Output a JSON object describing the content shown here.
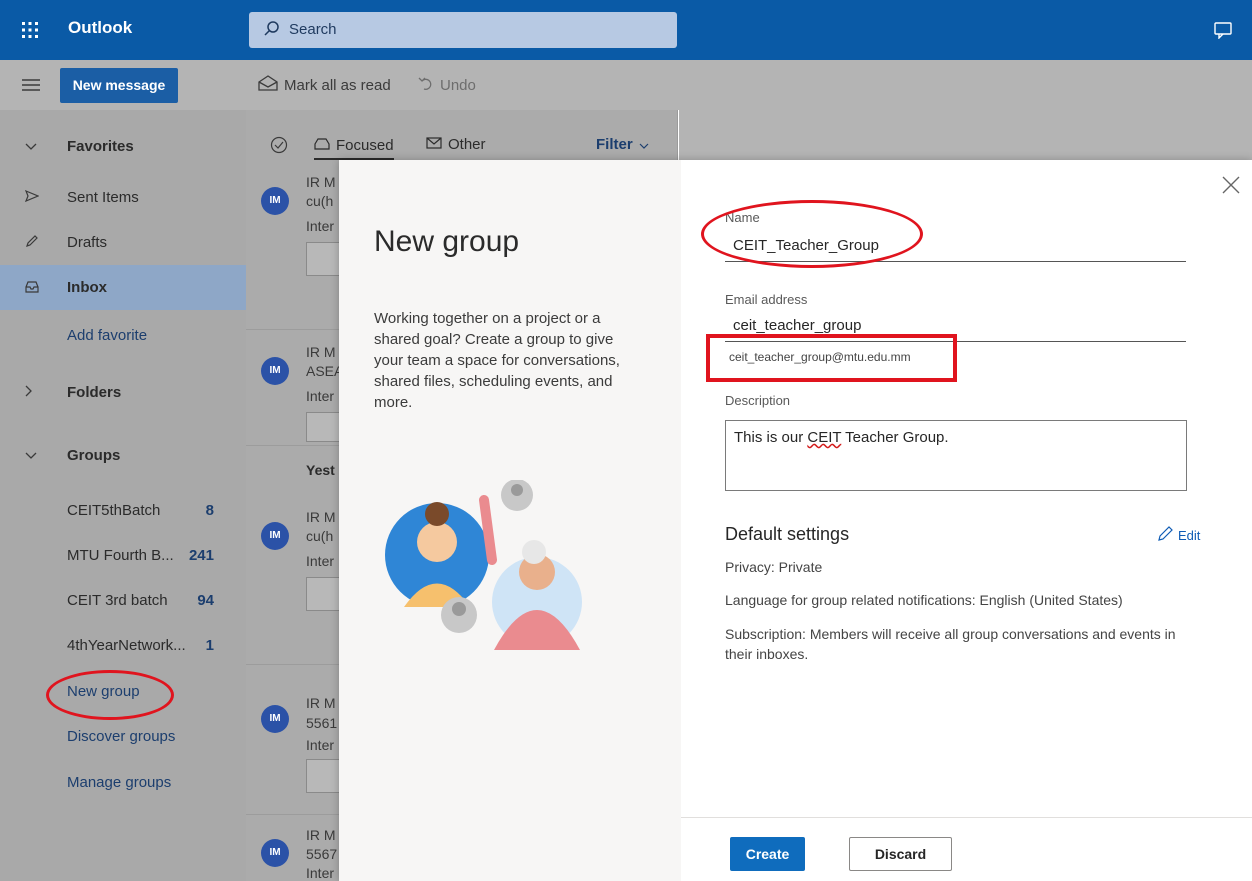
{
  "app": {
    "title": "Outlook"
  },
  "search": {
    "placeholder": "Search"
  },
  "toolbar": {
    "new_message": "New message",
    "mark_all_read": "Mark all as read",
    "undo": "Undo"
  },
  "sidebar": {
    "favorites": "Favorites",
    "sent_items": "Sent Items",
    "drafts": "Drafts",
    "inbox": "Inbox",
    "add_favorite": "Add favorite",
    "folders": "Folders",
    "groups": "Groups",
    "group_items": [
      {
        "label": "CEIT5thBatch",
        "count": "8"
      },
      {
        "label": "MTU Fourth B...",
        "count": "241"
      },
      {
        "label": "CEIT 3rd batch",
        "count": "94"
      },
      {
        "label": "4thYearNetwork...",
        "count": "1"
      }
    ],
    "new_group": "New group",
    "discover_groups": "Discover groups",
    "manage_groups": "Manage groups"
  },
  "list": {
    "tab_focused": "Focused",
    "tab_other": "Other",
    "filter": "Filter",
    "yesterday": "Yest",
    "items": [
      {
        "avatar": "IM",
        "line1": "IR M",
        "line2": "cu(h",
        "line3": "Inter"
      },
      {
        "avatar": "IM",
        "line1": "IR M",
        "line2": "ASEA",
        "line3": "Inter"
      },
      {
        "avatar": "IM",
        "line1": "IR M",
        "line2": "cu(h",
        "line3": "Inter"
      },
      {
        "avatar": "IM",
        "line1": "IR M",
        "line2": "5561",
        "line3": "Inter"
      },
      {
        "avatar": "IM",
        "line1": "IR M",
        "line2": "5567",
        "line3": "Inter"
      }
    ]
  },
  "dialog": {
    "title": "New group",
    "description": "Working together on a project or a shared goal? Create a group to give your team a space for conversations, shared files, scheduling events, and more.",
    "name_label": "Name",
    "name_value": "CEIT_Teacher_Group",
    "email_label": "Email address",
    "email_value": "ceit_teacher_group",
    "email_full": "ceit_teacher_group@mtu.edu.mm",
    "description_label": "Description",
    "description_pre": "This is our ",
    "description_word": "CEIT",
    "description_post": " Teacher Group.",
    "defaults_title": "Default settings",
    "edit": "Edit",
    "privacy": "Privacy: Private",
    "language": "Language for group related notifications: English (United States)",
    "subscription": "Subscription: Members will receive all group conversations and events in their inboxes.",
    "create": "Create",
    "discard": "Discard"
  }
}
